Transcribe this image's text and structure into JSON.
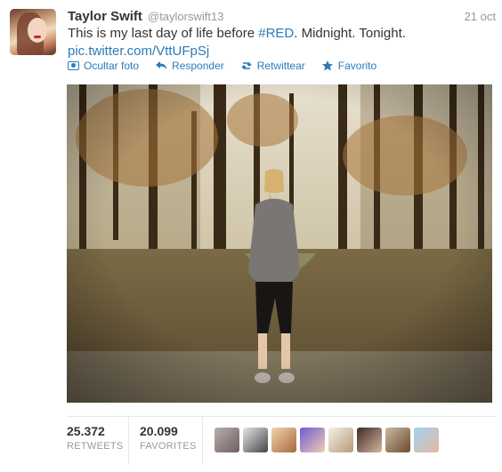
{
  "tweet": {
    "author_name": "Taylor Swift",
    "author_handle": "@taylorswift13",
    "date": "21 oct",
    "text_before": "This is my last day of life before ",
    "hashtag": "#RED",
    "text_after": ". Midnight. Tonight.",
    "link": "pic.twitter.com/VttUFpSj"
  },
  "actions": {
    "hide_photo": "Ocultar foto",
    "reply": "Responder",
    "retweet": "Retwittear",
    "favorite": "Favorito"
  },
  "stats": {
    "retweets_count": "25.372",
    "retweets_label": "RETWEETS",
    "favorites_count": "20.099",
    "favorites_label": "FAVORITES"
  },
  "colors": {
    "link": "#2b7bb9",
    "muted": "#999999",
    "text": "#333333"
  },
  "icons": [
    "photo-icon",
    "reply-icon",
    "retweet-icon",
    "star-icon"
  ],
  "favoriter_avatars": [
    {
      "colors": [
        "#b9aeb0",
        "#6f5e5c"
      ]
    },
    {
      "colors": [
        "#e6e6e6",
        "#444444"
      ]
    },
    {
      "colors": [
        "#f2d3b2",
        "#a56a3b"
      ]
    },
    {
      "colors": [
        "#6b5bd3",
        "#f3cdb3"
      ]
    },
    {
      "colors": [
        "#f3f0e8",
        "#b59b78"
      ]
    },
    {
      "colors": [
        "#3b2a2a",
        "#d9b59c"
      ]
    },
    {
      "colors": [
        "#c9b9a1",
        "#6e4a2c"
      ]
    },
    {
      "colors": [
        "#9ed4ef",
        "#e7b7a5"
      ]
    }
  ]
}
